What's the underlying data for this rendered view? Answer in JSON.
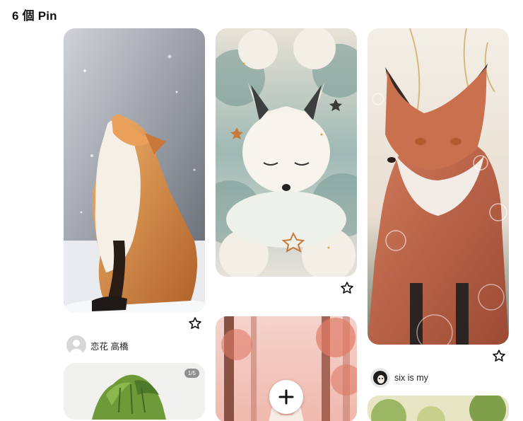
{
  "header": {
    "pin_count": "6 個 Pin"
  },
  "pins": [
    {
      "author": "恋花 高橋",
      "icon": "star-outline-icon"
    },
    {
      "badge": "1/5"
    },
    {
      "icon": "star-outline-icon"
    },
    {
      "icon": "plus-icon"
    },
    {
      "author": "six is my",
      "icon": "star-outline-icon"
    }
  ],
  "colors": {
    "accent_dark": "#111111",
    "card_background": "#f0f0f0"
  }
}
